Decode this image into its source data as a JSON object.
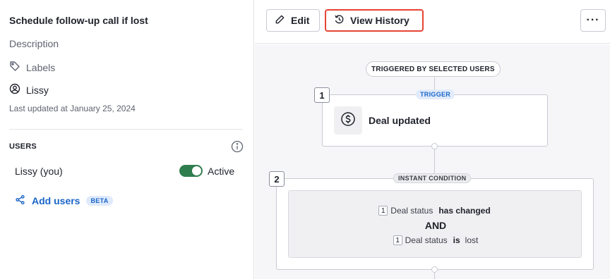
{
  "sidebar": {
    "title": "Schedule follow-up call if lost",
    "description": "Description",
    "labels": "Labels",
    "owner": "Lissy",
    "last_updated": "Last updated at January 25, 2024",
    "users_heading": "USERS",
    "users": [
      {
        "name": "Lissy (you)",
        "status_label": "Active",
        "active": true
      }
    ],
    "add_users_label": "Add users",
    "beta_badge": "BETA"
  },
  "toolbar": {
    "edit_label": "Edit",
    "history_label": "View History",
    "more_label": "···"
  },
  "canvas": {
    "entry_label": "TRIGGERED BY SELECTED USERS",
    "steps": [
      {
        "number": "1",
        "badge": "TRIGGER",
        "title": "Deal updated",
        "icon": "dollar-circle-icon"
      },
      {
        "number": "2",
        "badge": "INSTANT CONDITION",
        "conditions": [
          {
            "ref": "1",
            "field": "Deal status",
            "operator": "has changed",
            "value": ""
          },
          {
            "ref": "1",
            "field": "Deal status",
            "operator": "is",
            "value": "lost"
          }
        ],
        "joiner": "AND"
      }
    ]
  },
  "colors": {
    "accent": "#1a66c9",
    "toggle_active": "#2e7d4f",
    "highlight_border": "#e64433",
    "canvas_bg": "#f6f6f8"
  }
}
